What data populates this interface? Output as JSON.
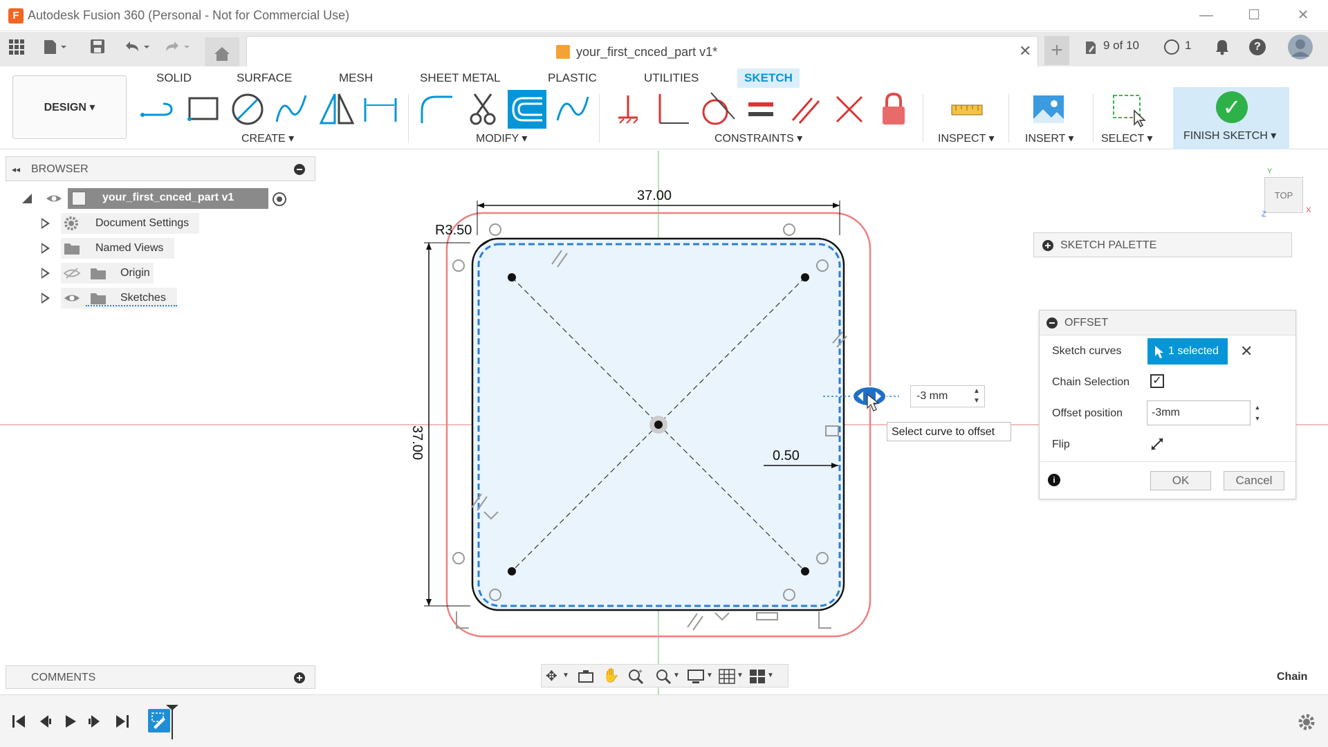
{
  "window": {
    "title": "Autodesk Fusion 360 (Personal - Not for Commercial Use)",
    "app_icon": "F"
  },
  "document": {
    "tab_title": "your_first_cnced_part v1*",
    "version_badge": "9 of 10",
    "jobs_count": "1"
  },
  "ribbon": {
    "workspace_button": "DESIGN ▾",
    "tabs": [
      "SOLID",
      "SURFACE",
      "MESH",
      "SHEET METAL",
      "PLASTIC",
      "UTILITIES",
      "SKETCH"
    ],
    "active_tab": "SKETCH",
    "groups": {
      "create": "CREATE ▾",
      "modify": "MODIFY ▾",
      "constraints": "CONSTRAINTS ▾",
      "inspect": "INSPECT ▾",
      "insert": "INSERT ▾",
      "select": "SELECT ▾",
      "finish": "FINISH SKETCH ▾"
    }
  },
  "browser": {
    "title": "BROWSER",
    "root": "your_first_cnced_part v1",
    "items": [
      {
        "label": "Document Settings",
        "icon": "gear-icon"
      },
      {
        "label": "Named Views",
        "icon": "folder-icon"
      },
      {
        "label": "Origin",
        "icon": "folder-icon"
      },
      {
        "label": "Sketches",
        "icon": "folder-icon"
      }
    ]
  },
  "comments": {
    "title": "COMMENTS"
  },
  "sketch_palette": {
    "title": "SKETCH PALETTE"
  },
  "offset_dialog": {
    "title": "OFFSET",
    "sketch_curves_label": "Sketch curves",
    "sketch_curves_value": "1 selected",
    "chain_selection_label": "Chain Selection",
    "chain_selection_checked": true,
    "offset_position_label": "Offset position",
    "offset_position_value": "-3mm",
    "flip_label": "Flip",
    "ok_label": "OK",
    "cancel_label": "Cancel"
  },
  "canvas": {
    "dim_width": "37.00",
    "dim_height": "37.00",
    "dim_radius": "R3.50",
    "dim_offset": "0.50",
    "offset_input": "-3 mm",
    "tooltip": "Select curve to offset",
    "status_right": "Chain",
    "viewcube_label": "TOP",
    "axis_x": "X",
    "axis_y": "Y",
    "axis_z": "Z"
  },
  "colors": {
    "accent": "#0696d7",
    "finish_green": "#2fb14a",
    "offset_preview": "#f08080",
    "sketch_fill": "#eaf4fc"
  }
}
